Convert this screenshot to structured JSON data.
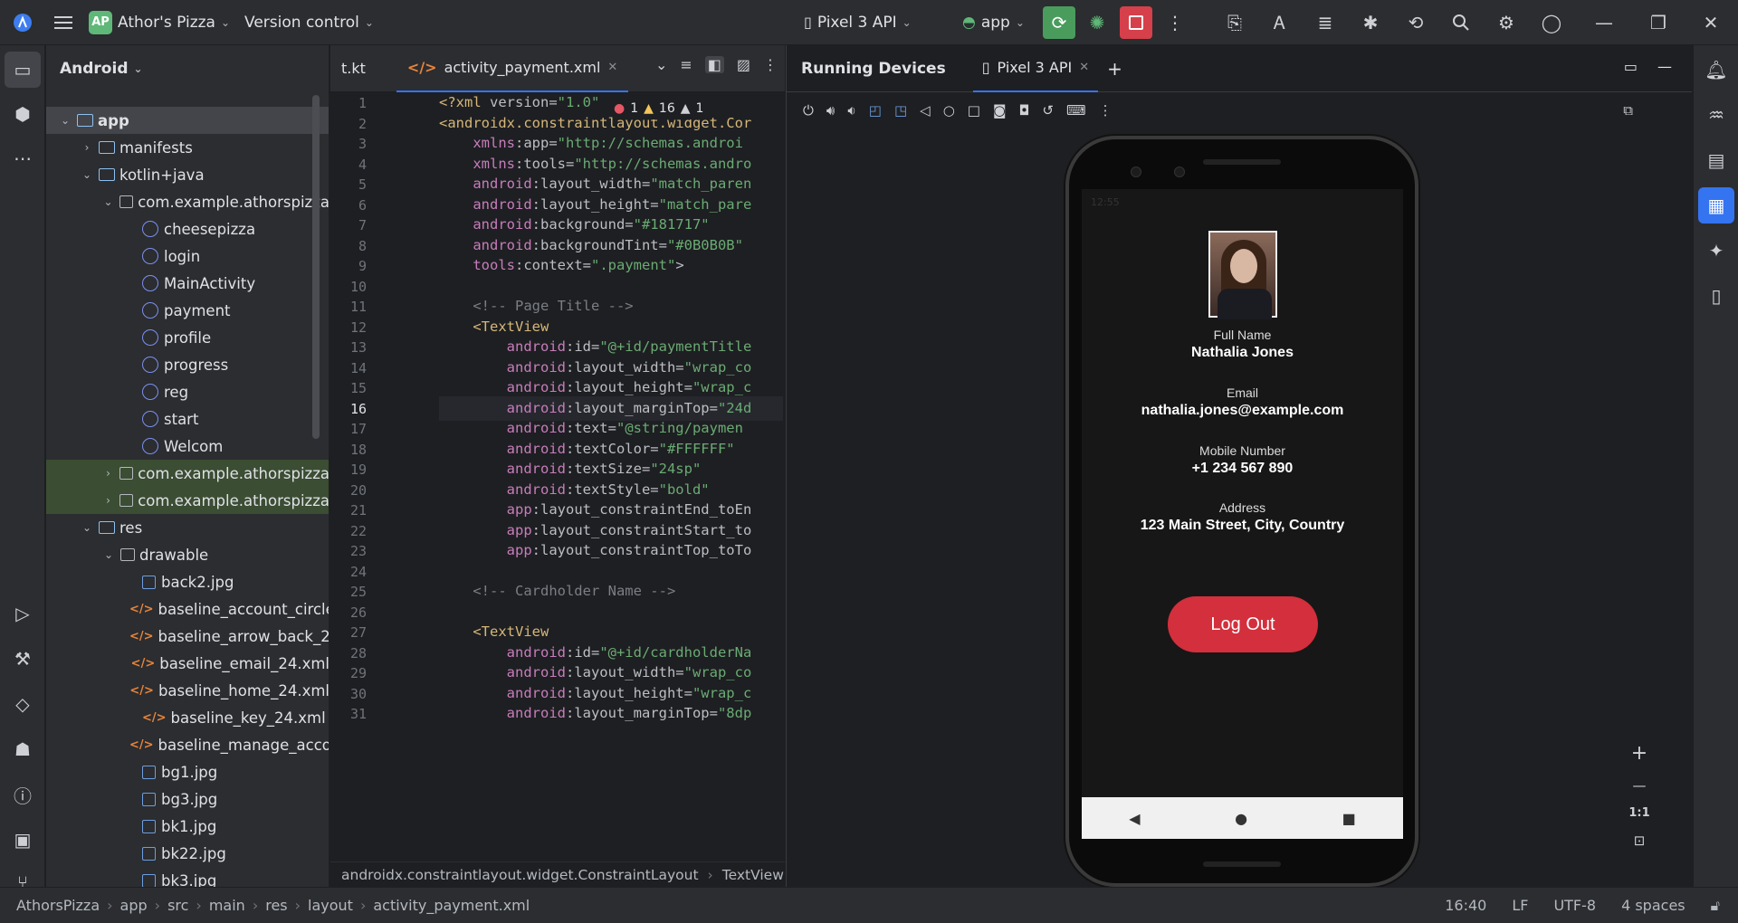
{
  "titlebar": {
    "project_initials": "AP",
    "project_name": "Athor's Pizza",
    "vcs": "Version control",
    "device": "Pixel 3 API",
    "run_config": "app"
  },
  "project_panel": {
    "view": "Android",
    "tree": [
      {
        "label": "app",
        "arrow": "⌄",
        "kind": "module",
        "indent": 0,
        "sel": true
      },
      {
        "label": "manifests",
        "arrow": "›",
        "kind": "folder",
        "indent": 1
      },
      {
        "label": "kotlin+java",
        "arrow": "⌄",
        "kind": "folder",
        "indent": 1
      },
      {
        "label": "com.example.athorspizza",
        "arrow": "⌄",
        "kind": "pkg",
        "indent": 2
      },
      {
        "label": "cheesepizza",
        "arrow": "",
        "kind": "kt",
        "indent": 3
      },
      {
        "label": "login",
        "arrow": "",
        "kind": "kt",
        "indent": 3
      },
      {
        "label": "MainActivity",
        "arrow": "",
        "kind": "kt",
        "indent": 3
      },
      {
        "label": "payment",
        "arrow": "",
        "kind": "kt",
        "indent": 3
      },
      {
        "label": "profile",
        "arrow": "",
        "kind": "kt",
        "indent": 3
      },
      {
        "label": "progress",
        "arrow": "",
        "kind": "kt",
        "indent": 3
      },
      {
        "label": "reg",
        "arrow": "",
        "kind": "kt",
        "indent": 3
      },
      {
        "label": "start",
        "arrow": "",
        "kind": "kt",
        "indent": 3
      },
      {
        "label": "Welcom",
        "arrow": "",
        "kind": "kt",
        "indent": 3
      },
      {
        "label": "com.example.athorspizza",
        "arrow": "›",
        "kind": "pkg",
        "indent": 2,
        "hl": true
      },
      {
        "label": "com.example.athorspizza",
        "arrow": "›",
        "kind": "pkg",
        "indent": 2,
        "hl": true
      },
      {
        "label": "res",
        "arrow": "⌄",
        "kind": "folder",
        "indent": 1
      },
      {
        "label": "drawable",
        "arrow": "⌄",
        "kind": "pkg",
        "indent": 2
      },
      {
        "label": "back2.jpg",
        "arrow": "",
        "kind": "img",
        "indent": 3
      },
      {
        "label": "baseline_account_circle",
        "arrow": "",
        "kind": "xml",
        "indent": 3
      },
      {
        "label": "baseline_arrow_back_2",
        "arrow": "",
        "kind": "xml",
        "indent": 3
      },
      {
        "label": "baseline_email_24.xml",
        "arrow": "",
        "kind": "xml",
        "indent": 3
      },
      {
        "label": "baseline_home_24.xml",
        "arrow": "",
        "kind": "xml",
        "indent": 3
      },
      {
        "label": "baseline_key_24.xml",
        "arrow": "",
        "kind": "xml",
        "indent": 3
      },
      {
        "label": "baseline_manage_acco",
        "arrow": "",
        "kind": "xml",
        "indent": 3
      },
      {
        "label": "bg1.jpg",
        "arrow": "",
        "kind": "img",
        "indent": 3
      },
      {
        "label": "bg3.jpg",
        "arrow": "",
        "kind": "img",
        "indent": 3
      },
      {
        "label": "bk1.jpg",
        "arrow": "",
        "kind": "img",
        "indent": 3
      },
      {
        "label": "bk22.jpg",
        "arrow": "",
        "kind": "img",
        "indent": 3
      },
      {
        "label": "bk3.jpg",
        "arrow": "",
        "kind": "img",
        "indent": 3
      }
    ]
  },
  "editor": {
    "tab_prev": "t.kt",
    "tab_active": "activity_payment.xml",
    "current_line": 16,
    "inspection": {
      "errors": "1",
      "warnings": "16",
      "weak": "1"
    },
    "lines": [
      "<?xml version=\"1.0\"",
      "<androidx.constraintlayout.widget.Cor",
      "    xmlns:app=\"http://schemas.androi",
      "    xmlns:tools=\"http://schemas.andro",
      "    android:layout_width=\"match_paren",
      "    android:layout_height=\"match_pare",
      "    android:background=\"#181717\"",
      "    android:backgroundTint=\"#0B0B0B\"",
      "    tools:context=\".payment\">",
      "",
      "    <!-- Page Title -->",
      "    <TextView",
      "        android:id=\"@+id/paymentTitle",
      "        android:layout_width=\"wrap_co",
      "        android:layout_height=\"wrap_c",
      "        android:layout_marginTop=\"24d",
      "        android:text=\"@string/paymen",
      "        android:textColor=\"#FFFFFF\"",
      "        android:textSize=\"24sp\"",
      "        android:textStyle=\"bold\"",
      "        app:layout_constraintEnd_toEn",
      "        app:layout_constraintStart_to",
      "        app:layout_constraintTop_toTo",
      "",
      "    <!-- Cardholder Name -->",
      "",
      "    <TextView",
      "        android:id=\"@+id/cardholderNa",
      "        android:layout_width=\"wrap_co",
      "        android:layout_height=\"wrap_c",
      "        android:layout_marginTop=\"8dp"
    ],
    "breadcrumb": [
      "androidx.constraintlayout.widget.ConstraintLayout",
      "TextView"
    ]
  },
  "devices": {
    "title": "Running Devices",
    "tab": "Pixel 3 API",
    "zoom_label": "1:1",
    "app": {
      "fields": [
        {
          "label": "Full Name",
          "value": "Nathalia Jones"
        },
        {
          "label": "Email",
          "value": "nathalia.jones@example.com"
        },
        {
          "label": "Mobile Number",
          "value": "+1 234 567 890"
        },
        {
          "label": "Address",
          "value": "123 Main Street, City, Country"
        }
      ],
      "logout": "Log Out",
      "status_time": "12:55"
    }
  },
  "statusbar": {
    "path": [
      "AthorsPizza",
      "app",
      "src",
      "main",
      "res",
      "layout",
      "activity_payment.xml"
    ],
    "position": "16:40",
    "line_sep": "LF",
    "encoding": "UTF-8",
    "indent": "4 spaces"
  }
}
